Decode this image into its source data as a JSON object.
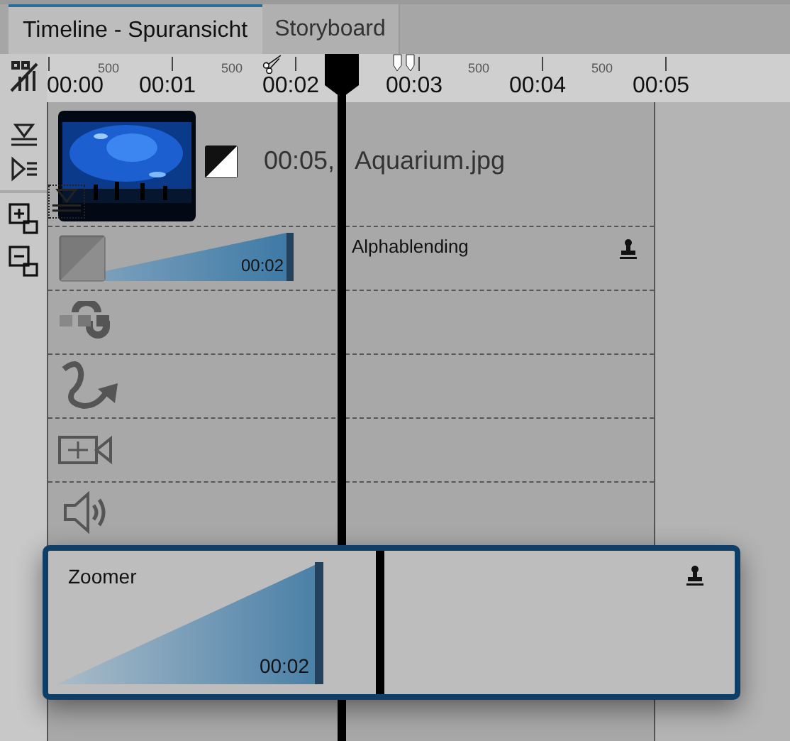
{
  "tabs": [
    {
      "label": "Timeline - Spuransicht",
      "selected": true
    },
    {
      "label": "Storyboard",
      "selected": false
    }
  ],
  "ruler": {
    "time_labels": [
      "00:00",
      "00:01",
      "00:02",
      "00:03",
      "00:04",
      "00:05"
    ],
    "sub_labels": [
      "500",
      "500",
      "500",
      "500"
    ]
  },
  "image_clip": {
    "kind": "picture",
    "duration": "00:05,",
    "file_name": "Aquarium.jpg"
  },
  "transition": {
    "name": "Alphablending",
    "duration": "00:02"
  },
  "zoom_window": {
    "effect": "Zoomer",
    "duration": "00:02"
  }
}
